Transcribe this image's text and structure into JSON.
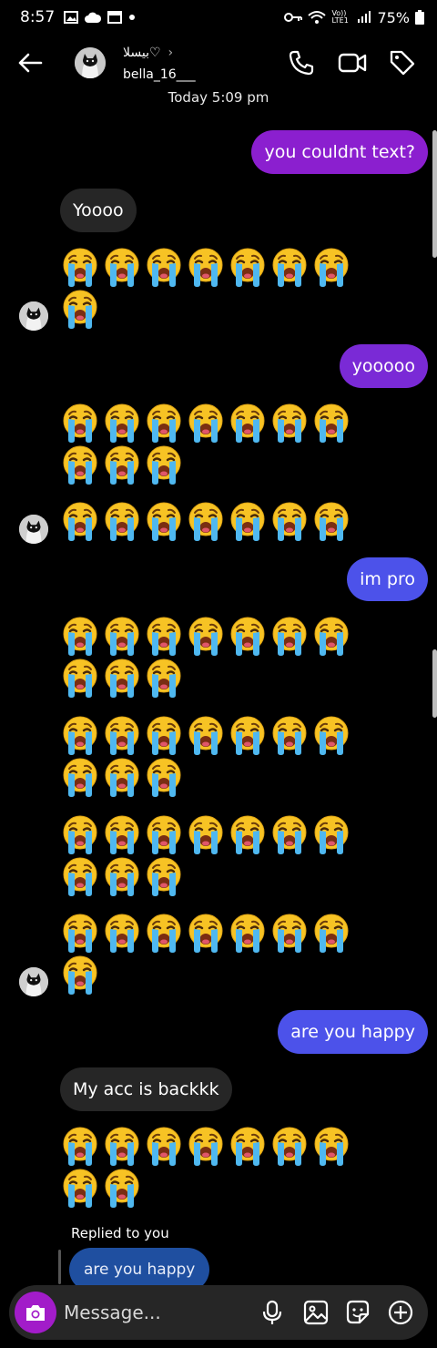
{
  "status": {
    "time": "8:57",
    "battery": "75%",
    "net_label": "Vo)) LTE1"
  },
  "header": {
    "display_name": "بيسلا♡",
    "handle": "bella_16___"
  },
  "date_label": "Today 5:09 pm",
  "messages": {
    "m1": "you couldnt text?",
    "m2": "Yoooo",
    "m3": "yooooo",
    "m4": "im pro",
    "m5": "are you happy",
    "m6": "My acc is backkk"
  },
  "reply": {
    "label": "Replied to you",
    "quoted": "are you happy"
  },
  "emoji_glyph": "😭",
  "composer": {
    "placeholder": "Message..."
  },
  "colors": {
    "purple": "#8b1fcf",
    "violet": "#7a2ad6",
    "blue": "#4c52ea",
    "incoming": "#262626",
    "camera": "#a21cc9"
  },
  "icons": [
    "back-arrow",
    "phone",
    "video-camera",
    "tag",
    "camera",
    "microphone",
    "image",
    "sticker",
    "plus"
  ]
}
